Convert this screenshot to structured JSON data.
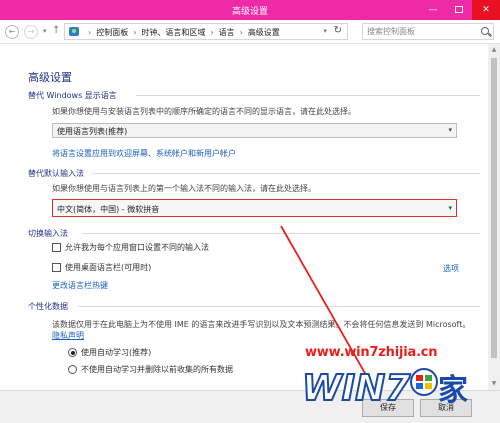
{
  "window": {
    "title": "高级设置"
  },
  "nav": {
    "breadcrumbs": [
      "控制面板",
      "时钟、语言和区域",
      "语言",
      "高级设置"
    ],
    "search_placeholder": "搜索控制面板"
  },
  "page": {
    "heading": "高级设置",
    "display_language": {
      "title": "替代 Windows 显示语言",
      "description": "如果你想使用与安装语言列表中的顺序所确定的语言不同的显示语言，请在此处选择。",
      "selected": "使用语言列表(推荐)",
      "link": "将语言设置应用到欢迎屏幕、系统帐户和新用户帐户"
    },
    "default_input": {
      "title": "替代默认输入法",
      "description": "如果你想使用与语言列表上的第一个输入法不同的输入法，请在此处选择。",
      "selected": "中文(简体，中国) - 微软拼音"
    },
    "switch_input": {
      "title": "切换输入法",
      "option_per_app": "允许我为每个应用窗口设置不同的输入法",
      "option_language_bar": "使用桌面语言栏(可用时)",
      "options_link": "选项",
      "hotkeys_link": "更改语言栏热键"
    },
    "personalization": {
      "title": "个性化数据",
      "description": "该数据仅用于在此电脑上为不使用 IME 的语言来改进手写识别以及文本预测结果。不会将任何信息发送到 Microsoft。",
      "privacy_link": "隐私声明",
      "radio_auto": "使用自动学习(推荐)",
      "radio_no_auto": "不使用自动学习并删除以前收集的所有数据"
    }
  },
  "footer": {
    "save_label": "保存",
    "cancel_label": "取消"
  },
  "watermark": {
    "url": "www.win7zhijia.cn",
    "logo_text": "WIN7",
    "logo_char": "家"
  },
  "colors": {
    "titlebar": "#ee2aa6",
    "heading": "#1e3287",
    "link": "#1a5fc0",
    "highlight": "#e2302a"
  }
}
